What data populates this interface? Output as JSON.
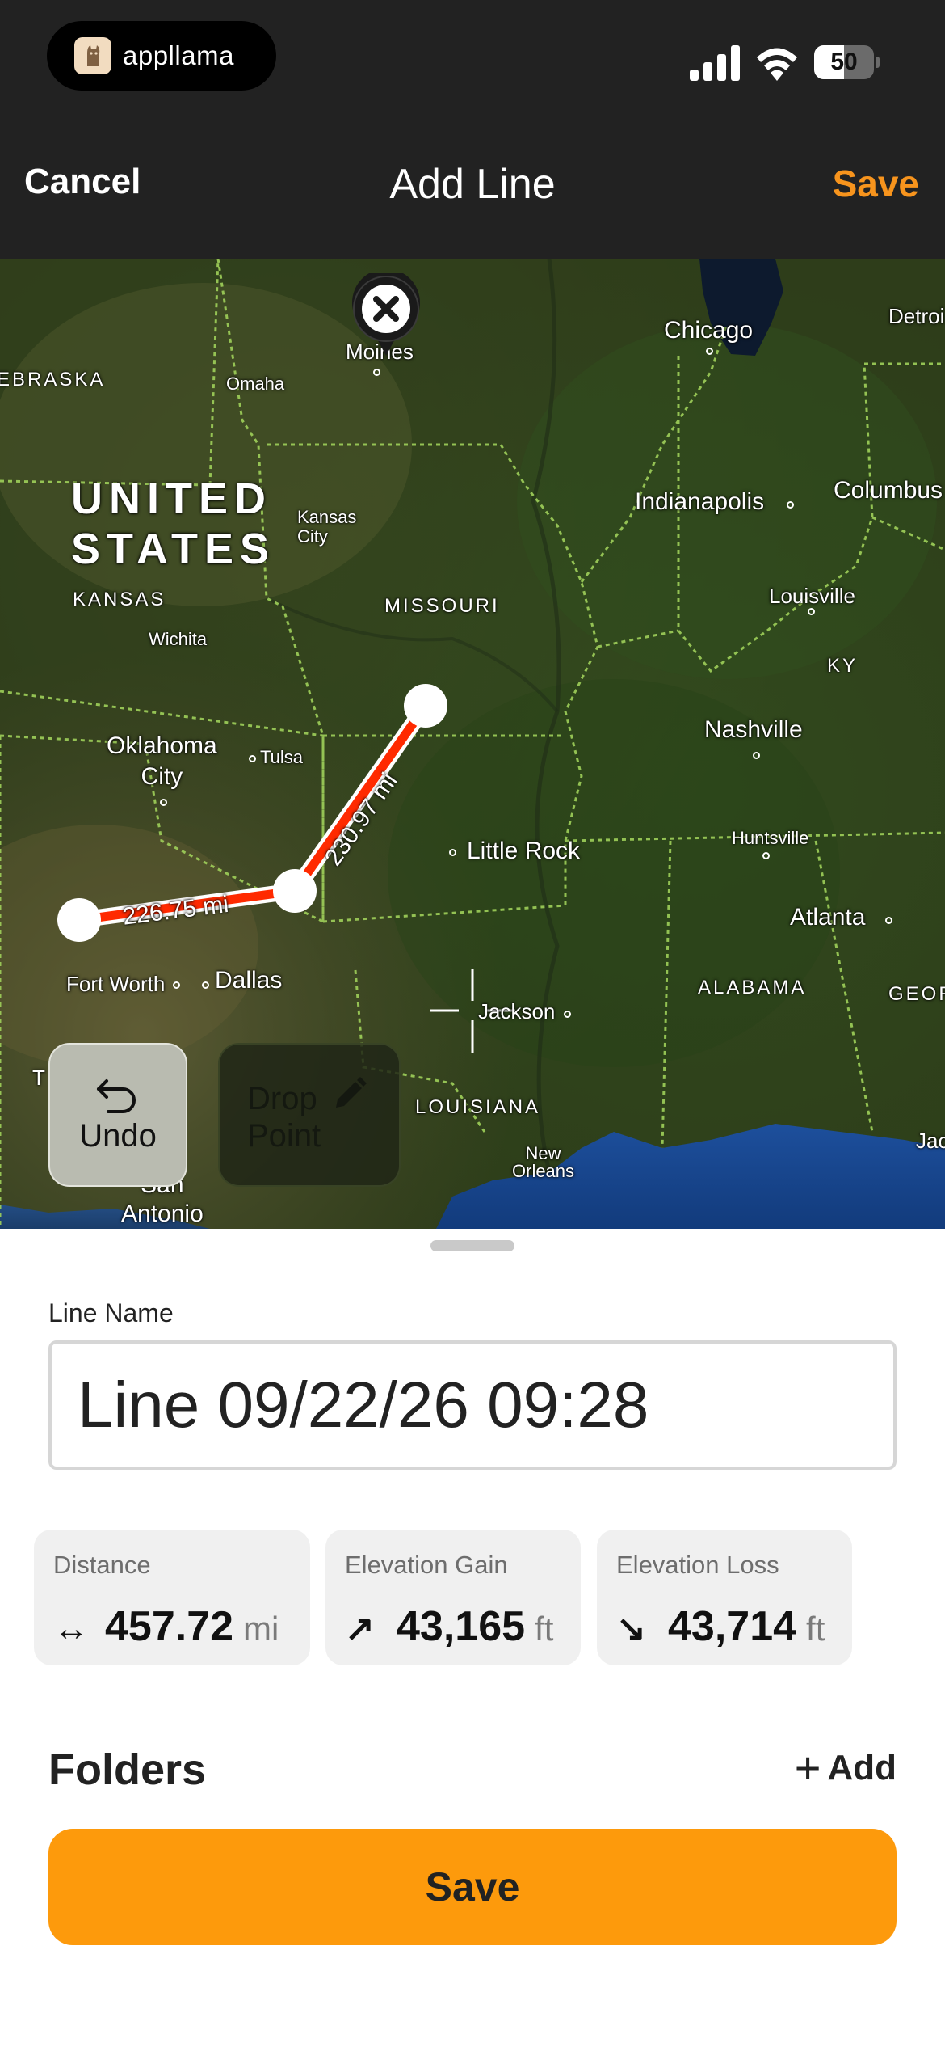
{
  "status_bar": {
    "app_logo_icon": "llama-icon",
    "app_brand": "appllama",
    "signal_icon": "cellular-signal-icon",
    "wifi_icon": "wifi-icon",
    "battery_level": "50",
    "battery_fraction": 0.5
  },
  "nav": {
    "cancel_label": "Cancel",
    "title": "Add Line",
    "save_label": "Save"
  },
  "map": {
    "labels": {
      "nebraska": "EBRASKA",
      "omaha": "Omaha",
      "des_moines": "Moines",
      "chicago": "Chicago",
      "detroit": "Detroi",
      "united_states": "UNITED\nSTATES",
      "kansas_city": "Kansas\nCity",
      "indianapolis": "Indianapolis",
      "columbus": "Columbus",
      "kansas": "KANSAS",
      "missouri": "MISSOURI",
      "louisville": "Louisville",
      "wichita": "Wichita",
      "ky": "KY",
      "oklahoma_city": "Oklahoma\nCity",
      "tulsa": "Tulsa",
      "nashville": "Nashville",
      "little_rock": "Little Rock",
      "huntsville": "Huntsville",
      "atlanta": "Atlanta",
      "fort_worth": "Fort Worth",
      "dallas": "Dallas",
      "alabama": "ALABAMA",
      "georgia": "GEOR",
      "jackson": "Jackson",
      "louisiana": "LOUISIANA",
      "new_orleans": "New\nOrleans",
      "san_antonio": "San\nAntonio",
      "jacksonville": "Jac",
      "texas_t": "T"
    },
    "segments": [
      {
        "distance_label": "226.75 mi"
      },
      {
        "distance_label": "230.97 mi"
      }
    ],
    "line_color": "#ff2a00",
    "remove_pin_icon": "close-pin-icon",
    "crosshair_icon": "crosshair-icon",
    "undo_label": "Undo",
    "undo_icon": "undo-arrow-icon",
    "drop_point_label": "Drop\nPoint",
    "drop_point_icon": "pencil-icon"
  },
  "sheet": {
    "line_name_label": "Line Name",
    "line_name_value": "Line 09/22/26 09:28",
    "stats": {
      "distance": {
        "title": "Distance",
        "icon": "horizontal-arrows-icon",
        "value": "457.72",
        "unit": "mi"
      },
      "elevation_gain": {
        "title": "Elevation Gain",
        "icon": "arrow-up-right-icon",
        "value": "43,165",
        "unit": "ft"
      },
      "elevation_loss": {
        "title": "Elevation Loss",
        "icon": "arrow-down-right-icon",
        "value": "43,714",
        "unit": "ft"
      }
    },
    "folders_title": "Folders",
    "add_label": "Add",
    "save_label": "Save"
  },
  "colors": {
    "accent": "#f7941d",
    "save_button": "#fd9a0c",
    "header_bg": "#222222"
  }
}
